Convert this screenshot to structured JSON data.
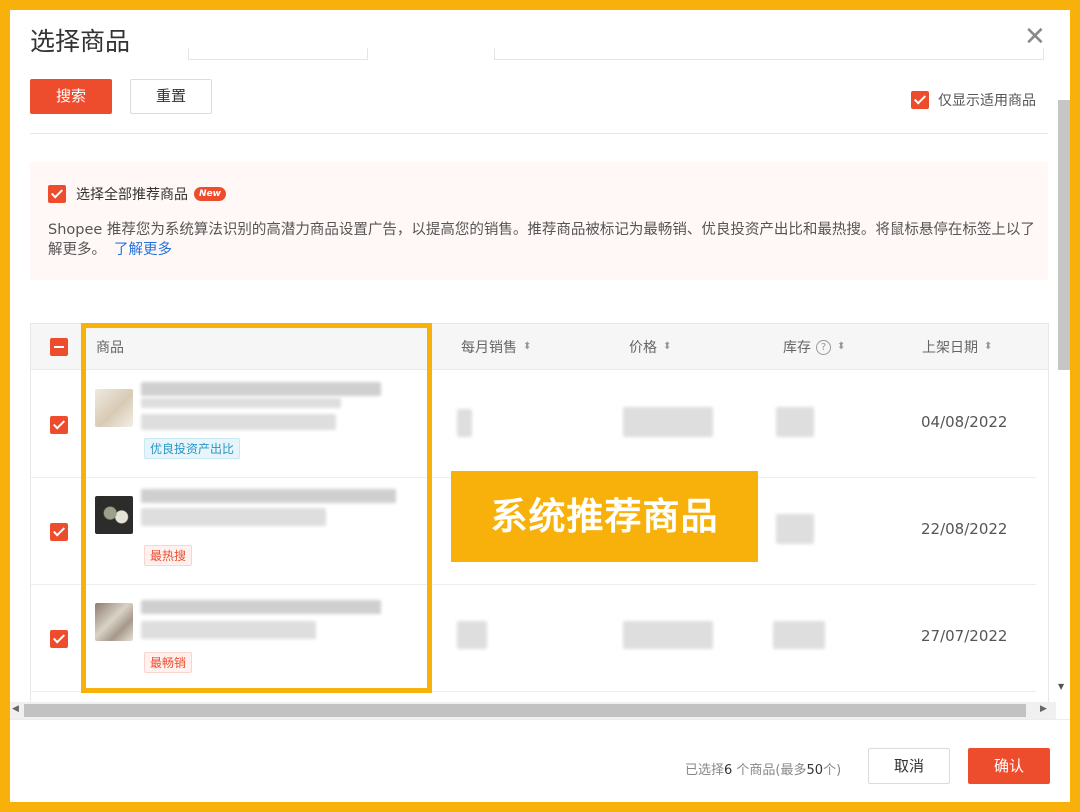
{
  "dialog": {
    "title": "选择商品",
    "close_glyph": "✕"
  },
  "filters": {
    "search_label": "搜索",
    "reset_label": "重置",
    "only_applicable_label": "仅显示适用商品",
    "only_applicable_checked": true
  },
  "recommendation": {
    "select_all_label": "选择全部推荐商品",
    "select_all_checked": true,
    "new_badge": "New",
    "description": "Shopee 推荐您为系统算法识别的高潜力商品设置广告，以提高您的销售。推荐商品被标记为最畅销、优良投资产出比和最热搜。将鼠标悬停在标签上以了解更多。",
    "learn_more": "了解更多"
  },
  "table": {
    "headers": {
      "product": "商品",
      "monthly_sales": "每月销售",
      "price": "价格",
      "stock": "库存",
      "listed_date": "上架日期"
    },
    "sort_glyph": "⬍",
    "help_glyph": "?",
    "rows": [
      {
        "tag": "优良投资产出比",
        "tag_style": "blue",
        "date": "04/08/2022",
        "checked": true
      },
      {
        "tag": "最热搜",
        "tag_style": "red",
        "date": "22/08/2022",
        "checked": true
      },
      {
        "tag": "最畅销",
        "tag_style": "red",
        "date": "27/07/2022",
        "checked": true
      }
    ]
  },
  "annotation": {
    "label": "系统推荐商品"
  },
  "footer": {
    "selected_prefix": "已选择",
    "selected_count": "6",
    "selected_suffix": " 个商品(最多",
    "max_count": "50",
    "max_suffix": "个)",
    "cancel_label": "取消",
    "confirm_label": "确认"
  },
  "colors": {
    "brand": "#ee4d2d",
    "highlight": "#f7b10a",
    "link": "#2673dd"
  }
}
